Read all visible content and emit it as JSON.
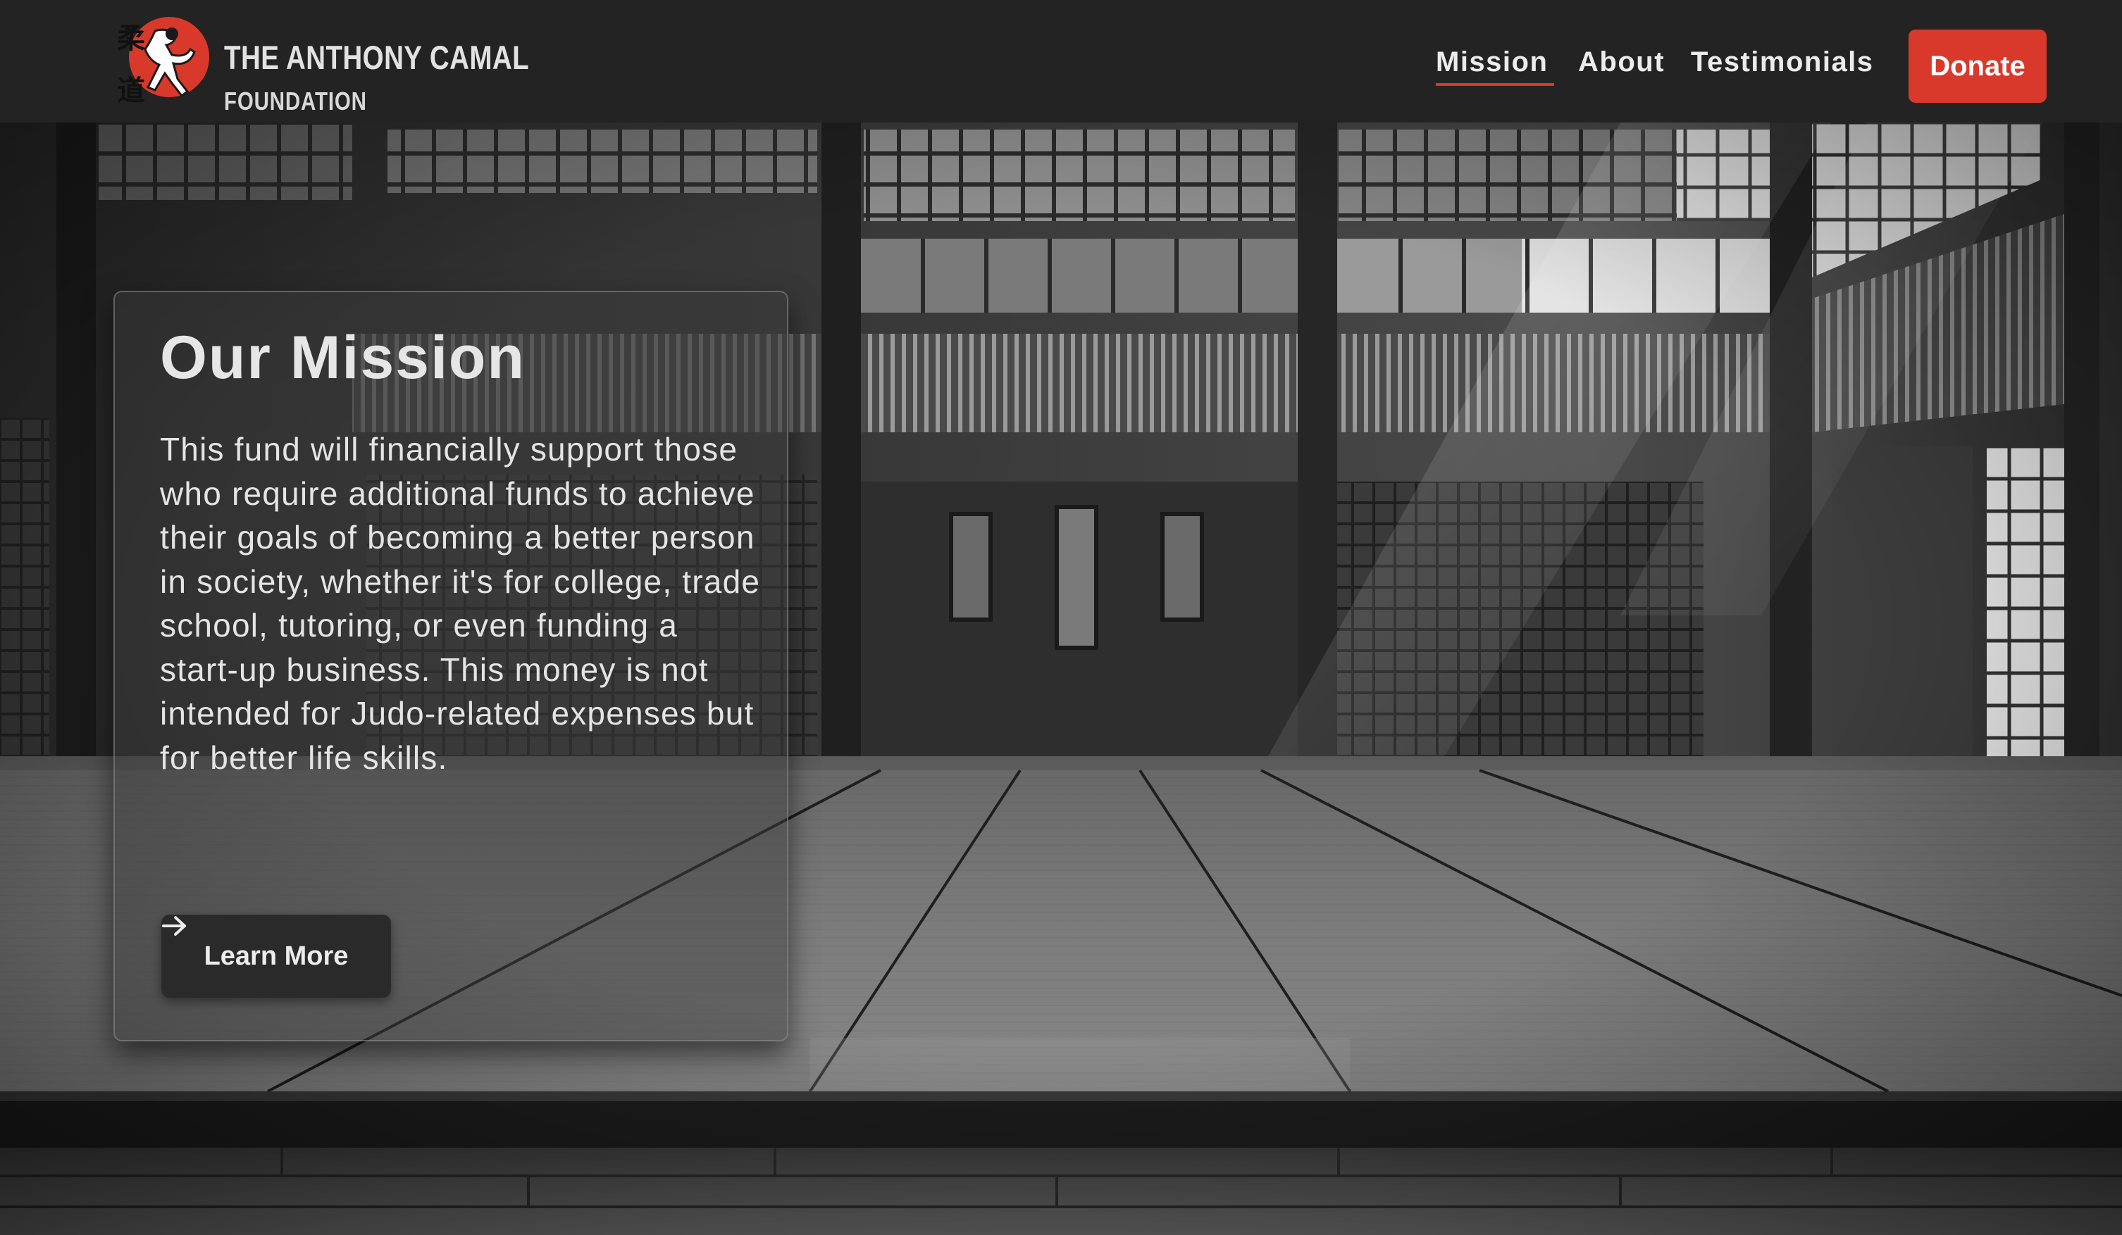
{
  "brand": {
    "name": "THE ANTHONY CAMAL",
    "subtitle": "FOUNDATION",
    "logo_glyphs": "柔道"
  },
  "nav": {
    "items": [
      {
        "label": "Mission",
        "active": true
      },
      {
        "label": "About",
        "active": false
      },
      {
        "label": "Testimonials",
        "active": false
      }
    ],
    "donate_label": "Donate"
  },
  "mission": {
    "title": "Our Mission",
    "body": "This fund will financially support those who require additional funds to achieve their goals of becoming a better person in society, whether it's for college, trade school, tutoring, or even funding a start-up business. This money is not intended for Judo-related expenses but for better life skills.",
    "cta_label": "Learn More"
  },
  "colors": {
    "accent": "#d9392b",
    "nav_bg": "#232323",
    "text_light": "#e6e6e6"
  },
  "icons": {
    "cta": "arrow-right-icon",
    "logo": "judo-logo-icon"
  }
}
